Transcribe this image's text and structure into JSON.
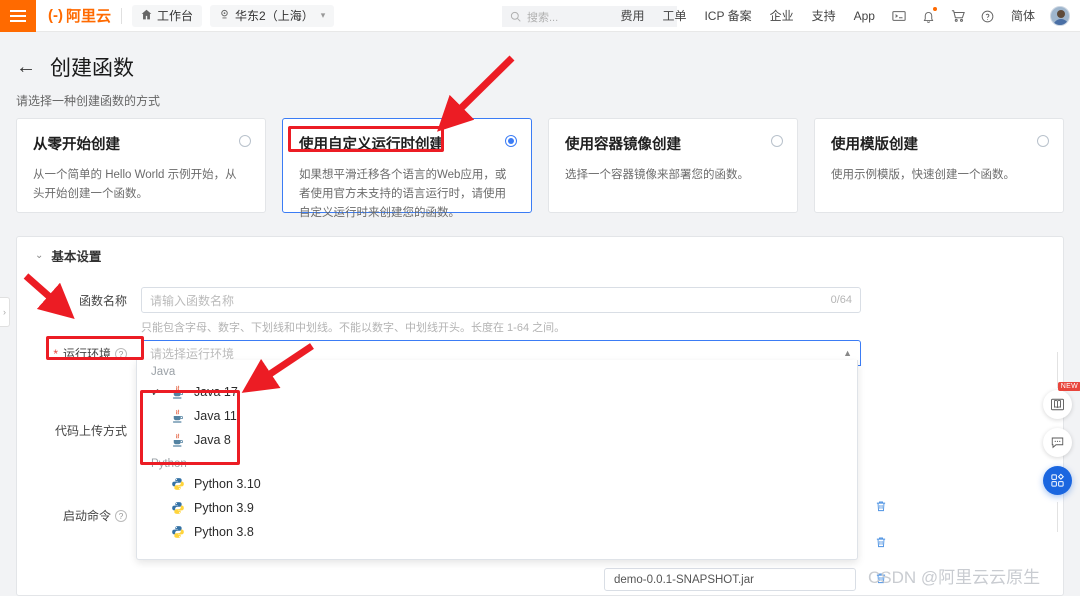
{
  "topbar": {
    "logo_text": "阿里云",
    "logo_mark": "(-)",
    "workbench": "工作台",
    "region": "华东2（上海）",
    "search_placeholder": "搜索...",
    "nav_items": [
      "费用",
      "工单",
      "ICP 备案",
      "企业",
      "支持",
      "App"
    ],
    "lang": "简体",
    "icons": [
      "terminal-icon",
      "bell-icon",
      "cart-icon",
      "help-icon"
    ]
  },
  "page": {
    "title": "创建函数",
    "subtitle": "请选择一种创建函数的方式"
  },
  "cards": [
    {
      "title": "从零开始创建",
      "desc": "从一个简单的 Hello World 示例开始，从头开始创建一个函数。",
      "selected": false
    },
    {
      "title": "使用自定义运行时创建",
      "desc": "如果想平滑迁移各个语言的Web应用，或者使用官方未支持的语言运行时，请使用自定义运行时来创建您的函数。",
      "selected": true
    },
    {
      "title": "使用容器镜像创建",
      "desc": "选择一个容器镜像来部署您的函数。",
      "selected": false
    },
    {
      "title": "使用模版创建",
      "desc": "使用示例模版，快速创建一个函数。",
      "selected": false
    }
  ],
  "panel": {
    "section_title": "基本设置",
    "fields": {
      "function_name": {
        "label": "函数名称",
        "placeholder": "请输入函数名称",
        "counter": "0/64",
        "hint": "只能包含字母、数字、下划线和中划线。不能以数字、中划线开头。长度在 1-64 之间。"
      },
      "runtime": {
        "label": "运行环境",
        "required": "*",
        "placeholder": "请选择运行环境"
      },
      "code_upload": {
        "label": "代码上传方式"
      },
      "start_command": {
        "label": "启动命令"
      }
    },
    "jar_file": "demo-0.0.1-SNAPSHOT.jar"
  },
  "dropdown": {
    "groups": [
      {
        "name": "Java",
        "options": [
          {
            "label": "Java 17",
            "icon": "java-icon",
            "checked": true
          },
          {
            "label": "Java 11",
            "icon": "java-icon",
            "checked": false
          },
          {
            "label": "Java 8",
            "icon": "java-icon",
            "checked": false
          }
        ]
      },
      {
        "name": "Python",
        "options": [
          {
            "label": "Python 3.10",
            "icon": "python-icon",
            "checked": false
          },
          {
            "label": "Python 3.9",
            "icon": "python-icon",
            "checked": false
          },
          {
            "label": "Python 3.8",
            "icon": "python-icon",
            "checked": false
          }
        ]
      }
    ]
  },
  "floating": {
    "new_badge": "NEW",
    "buttons": [
      "book-icon",
      "chat-icon",
      "apps-icon"
    ]
  },
  "watermark": "CSDN @阿里云云原生",
  "colors": {
    "brand_orange": "#ff6a00",
    "accent_blue": "#3b7cf5",
    "annotation_red": "#ec1c24",
    "trash_blue": "#4a90e2"
  }
}
